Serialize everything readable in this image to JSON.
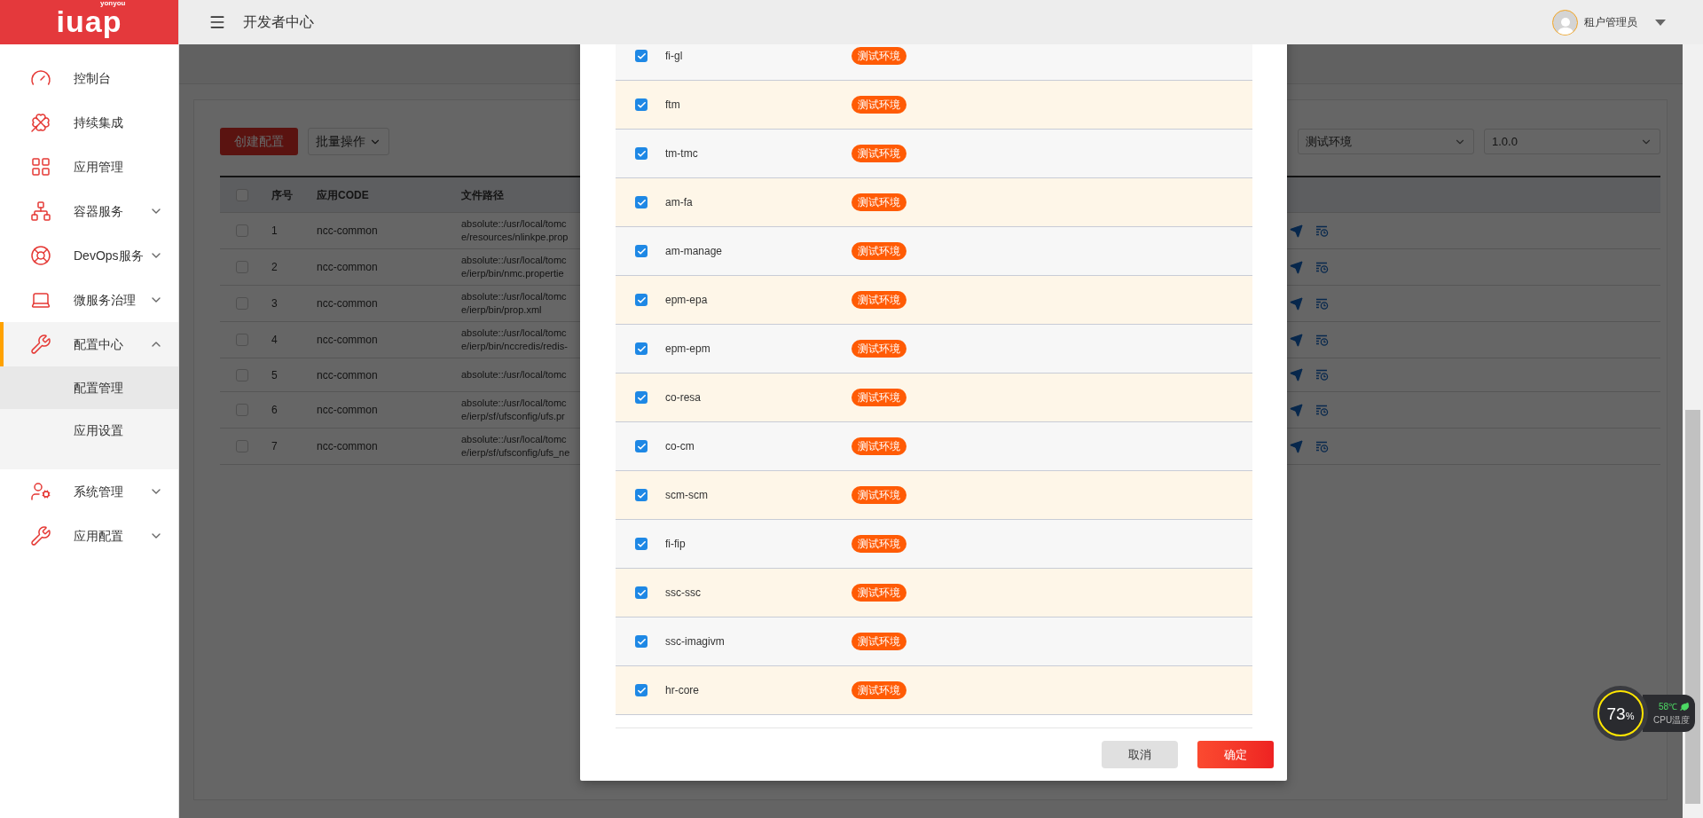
{
  "sidebar": {
    "logo": {
      "text": "iuap",
      "brand": "yonyou"
    },
    "items": [
      {
        "label": "控制台",
        "selected": false
      },
      {
        "label": "持续集成",
        "selected": false
      },
      {
        "label": "应用管理",
        "selected": false
      },
      {
        "label": "容器服务",
        "selected": false,
        "expanded": false
      },
      {
        "label": "DevOps服务",
        "selected": false,
        "expanded": false
      },
      {
        "label": "微服务治理",
        "selected": false,
        "expanded": false
      },
      {
        "label": "配置中心",
        "selected": true,
        "expanded": true,
        "children": [
          {
            "label": "配置管理",
            "selected": true
          },
          {
            "label": "应用设置",
            "selected": false
          }
        ]
      },
      {
        "label": "系统管理",
        "selected": false,
        "expanded": false
      },
      {
        "label": "应用配置",
        "selected": false,
        "expanded": false
      }
    ]
  },
  "header": {
    "title": "开发者中心",
    "user": "租户管理员"
  },
  "page": {
    "create_button": "创建配置",
    "batch_button": "批量操作",
    "filters": [
      "测试环境",
      "1.0.0"
    ],
    "table": {
      "columns": [
        "序号",
        "应用CODE",
        "文件路径"
      ],
      "header_checked": false,
      "rows": [
        {
          "index": "1",
          "code": "ncc-common",
          "path": [
            "absolute::/usr/local/tomc",
            "e/resources/nlinkpe.prop"
          ],
          "checked": false
        },
        {
          "index": "2",
          "code": "ncc-common",
          "path": [
            "absolute::/usr/local/tomc",
            "e/ierp/bin/nmc.propertie"
          ],
          "checked": false
        },
        {
          "index": "3",
          "code": "ncc-common",
          "path": [
            "absolute::/usr/local/tomc",
            "e/ierp/bin/prop.xml"
          ],
          "checked": false
        },
        {
          "index": "4",
          "code": "ncc-common",
          "path": [
            "absolute::/usr/local/tomc",
            "e/ierp/bin/nccredis/redis-"
          ],
          "checked": false
        },
        {
          "index": "5",
          "code": "ncc-common",
          "path": [
            "absolute::/usr/local/tomc"
          ],
          "checked": false
        },
        {
          "index": "6",
          "code": "ncc-common",
          "path": [
            "absolute::/usr/local/tomc",
            "e/ierp/sf/ufsconfig/ufs.pr"
          ],
          "checked": false
        },
        {
          "index": "7",
          "code": "ncc-common",
          "path": [
            "absolute::/usr/local/tomc",
            "e/ierp/sf/ufsconfig/ufs_ne"
          ],
          "checked": false
        }
      ]
    }
  },
  "modal": {
    "rows": [
      {
        "name": "fi-gl",
        "checked": true,
        "tag": "测试环境"
      },
      {
        "name": "ftm",
        "checked": true,
        "tag": "测试环境"
      },
      {
        "name": "tm-tmc",
        "checked": true,
        "tag": "测试环境"
      },
      {
        "name": "am-fa",
        "checked": true,
        "tag": "测试环境"
      },
      {
        "name": "am-manage",
        "checked": true,
        "tag": "测试环境"
      },
      {
        "name": "epm-epa",
        "checked": true,
        "tag": "测试环境"
      },
      {
        "name": "epm-epm",
        "checked": true,
        "tag": "测试环境"
      },
      {
        "name": "co-resa",
        "checked": true,
        "tag": "测试环境"
      },
      {
        "name": "co-cm",
        "checked": true,
        "tag": "测试环境"
      },
      {
        "name": "scm-scm",
        "checked": true,
        "tag": "测试环境"
      },
      {
        "name": "fi-fip",
        "checked": true,
        "tag": "测试环境"
      },
      {
        "name": "ssc-ssc",
        "checked": true,
        "tag": "测试环境"
      },
      {
        "name": "ssc-imagivm",
        "checked": true,
        "tag": "测试环境"
      },
      {
        "name": "hr-core",
        "checked": true,
        "tag": "测试环境"
      }
    ],
    "cancel": "取消",
    "confirm": "确定"
  },
  "cpu_widget": {
    "percent": "73",
    "unit": "%",
    "temperature": "58℃",
    "label": "CPU温度"
  }
}
